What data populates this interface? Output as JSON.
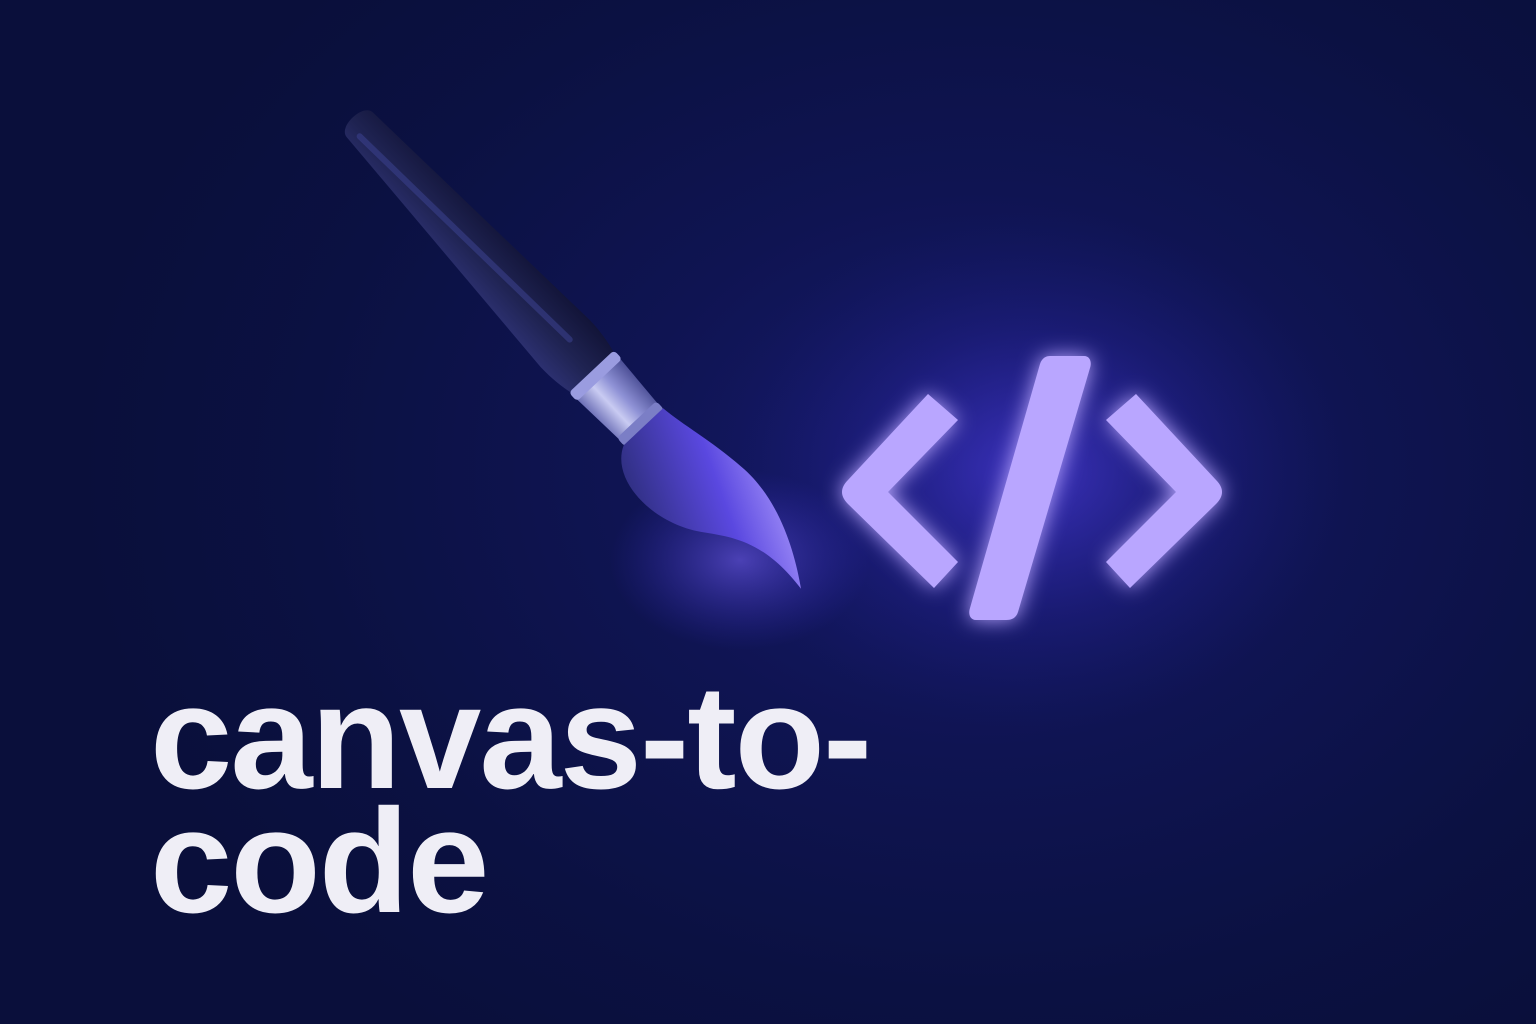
{
  "title": {
    "line1": "canvas-to-",
    "line2": "code"
  },
  "icons": [
    "paintbrush-icon",
    "code-brackets-icon"
  ],
  "colors": {
    "background": "#0b1142",
    "glow": "#6c54ff",
    "code_symbol": "#b9a6ff",
    "title_text": "#efeef6",
    "brush_handle": "#1f2250",
    "brush_ferrule": "#a8aadb"
  }
}
